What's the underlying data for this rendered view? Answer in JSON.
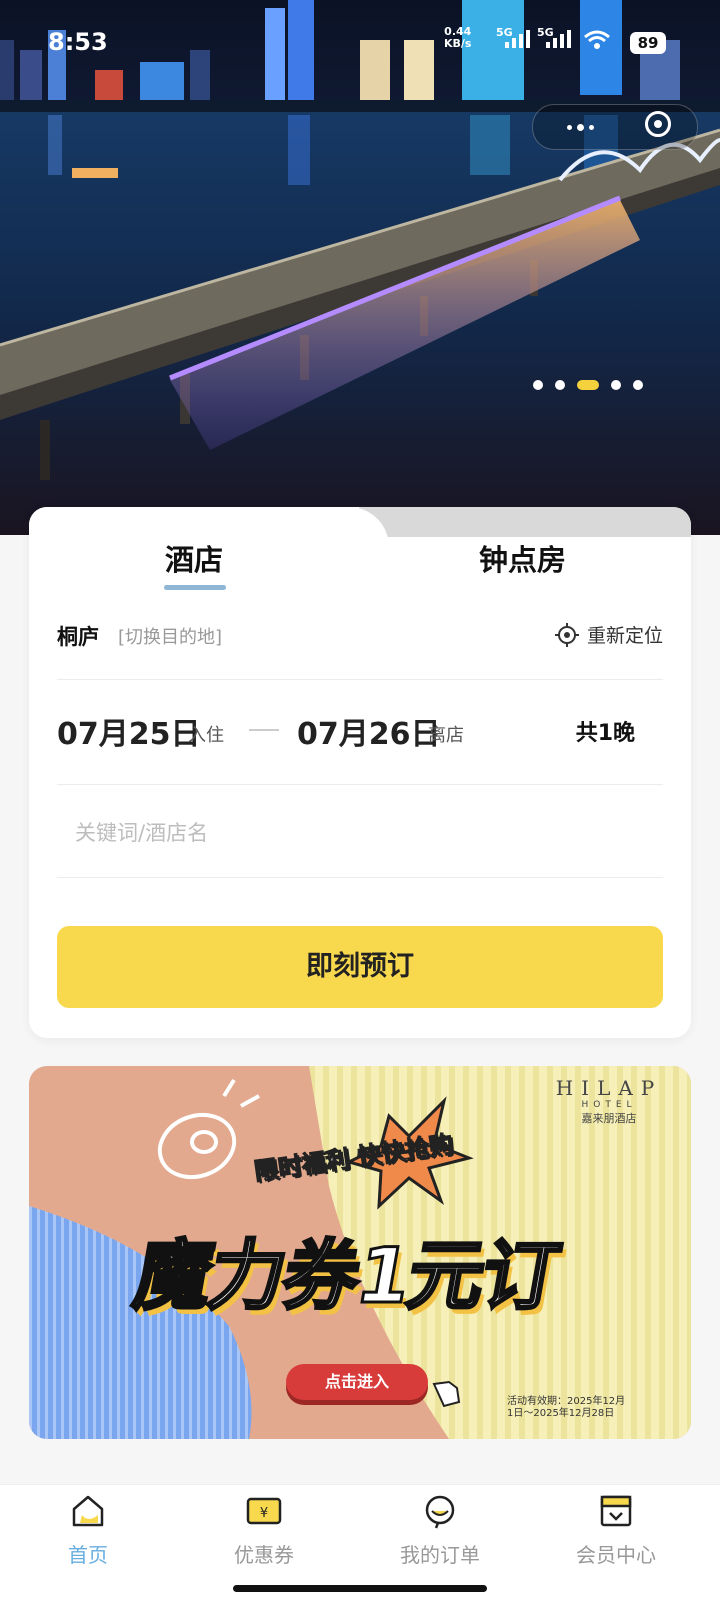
{
  "status_bar": {
    "time": "8:53",
    "net_speed": "0.44",
    "net_unit": "KB/s",
    "sim1": "5G",
    "sim2": "5G",
    "battery": "89"
  },
  "carousel": {
    "total": 5,
    "active_index": 2
  },
  "booking": {
    "tabs": [
      "酒店",
      "钟点房"
    ],
    "active_tab": 0,
    "city": "桐庐",
    "switch_label": "[切换目的地]",
    "relocate_label": "重新定位",
    "checkin_date": "07月25日",
    "checkin_label": "入住",
    "checkout_date": "07月26日",
    "checkout_label": "离店",
    "nights": "共1晚",
    "keyword_placeholder": "关键词/酒店名",
    "book_button": "即刻预订"
  },
  "promo": {
    "brand_en": "HILAP",
    "brand_sub": "HOTEL",
    "brand_cn": "嘉来朋酒店",
    "tagline": "限时福利 快快抢购",
    "title": "魔力券1元订",
    "button": "点击进入",
    "validity_line1": "活动有效期：2025年12月",
    "validity_line2": "1日～2025年12月28日"
  },
  "bottom_nav": {
    "items": [
      {
        "label": "首页",
        "icon": "home-icon"
      },
      {
        "label": "优惠券",
        "icon": "coupon-icon"
      },
      {
        "label": "我的订单",
        "icon": "order-icon"
      },
      {
        "label": "会员中心",
        "icon": "member-icon"
      }
    ],
    "active_index": 0
  },
  "colors": {
    "accent_yellow": "#f8d84d",
    "accent_blue": "#67aee0",
    "promo_red": "#d83c3a"
  }
}
